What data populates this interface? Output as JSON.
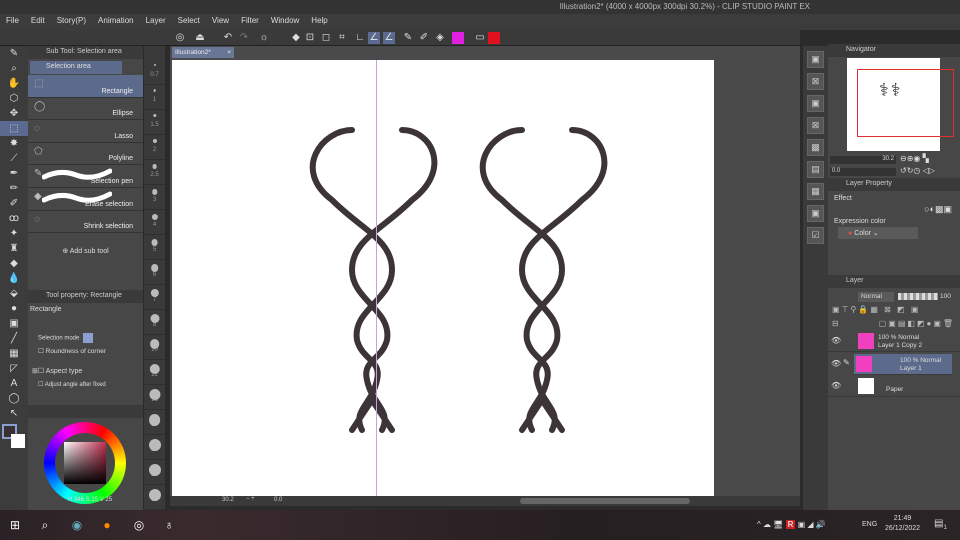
{
  "title": "Illustration2* (4000 x 4000px 300dpi 30.2%) - CLIP STUDIO PAINT EX",
  "menu": [
    "File",
    "Edit",
    "Story(P)",
    "Animation",
    "Layer",
    "Select",
    "View",
    "Filter",
    "Window",
    "Help"
  ],
  "subtool": {
    "header": "Sub Tool: Selection area",
    "group": "Selection area",
    "items": [
      "Rectangle",
      "Ellipse",
      "Lasso",
      "Polyline",
      "Selection pen",
      "Erase selection",
      "Shrink selection"
    ],
    "add": "Add sub tool"
  },
  "brush_sizes": [
    "0.7",
    "1",
    "1.5",
    "2",
    "2.5",
    "3",
    "4",
    "5",
    "6",
    "7",
    "8",
    "10",
    "12",
    "15",
    "17",
    "20",
    "25",
    "30"
  ],
  "toolprop": {
    "header": "Tool property: Rectangle",
    "name": "Rectangle",
    "selection_mode": "Selection mode",
    "roundness": "Roundness of corner",
    "aspect": "Aspect type",
    "adjust": "Adjust angle after fixed"
  },
  "color": {
    "h": "346",
    "s": "15",
    "v": "25",
    "main": "#3a3034",
    "sub": "#ffffff"
  },
  "doc_tab": "Illustration2*",
  "status": {
    "zoom": "30.2",
    "angle": "0.0"
  },
  "navigator": {
    "header": "Navigator",
    "zoom": "30.2",
    "angle": "0.0"
  },
  "layerprop": {
    "header": "Layer Property",
    "effect": "Effect",
    "expr": "Expression color",
    "color": "Color"
  },
  "layers": {
    "header": "Layer",
    "blend": "Normal",
    "opacity": "100",
    "items": [
      {
        "mode": "100 % Normal",
        "name": "Layer 1 Copy 2"
      },
      {
        "mode": "100 % Normal",
        "name": "Layer 1"
      },
      {
        "mode": "",
        "name": "Paper"
      }
    ]
  },
  "taskbar": {
    "lang": "ENG",
    "time": "21:49",
    "date": "26/12/2022",
    "notif": "1"
  }
}
